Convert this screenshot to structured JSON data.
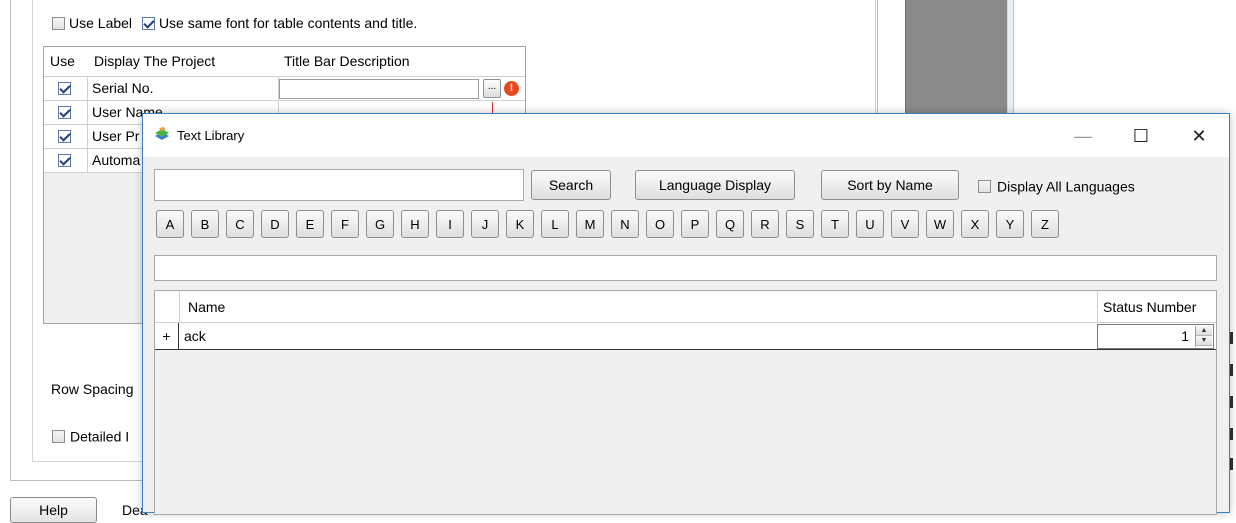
{
  "background_dialog": {
    "options": {
      "use_label": {
        "label": "Use Label",
        "checked": false
      },
      "same_font": {
        "label": "Use same font for table contents and title.",
        "checked": true
      }
    },
    "project_table": {
      "headers": [
        "Use",
        "Display The Project",
        "Title Bar Description"
      ],
      "rows": [
        {
          "checked": true,
          "label": "Serial No."
        },
        {
          "checked": true,
          "label": "User Name"
        },
        {
          "checked": true,
          "label": "User Pr"
        },
        {
          "checked": true,
          "label": "Automa"
        }
      ],
      "browse_button_label": "...",
      "error_icon_glyph": "!"
    },
    "row_spacing_label": "Row Spacing",
    "detailed_label": "Detailed I",
    "help_button_label": "Help",
    "partial_button_label": "Dea"
  },
  "text_library": {
    "window_title": "Text Library",
    "window_controls": {
      "minimize": "—",
      "maximize": "☐",
      "close": "✕"
    },
    "search_input": {
      "value": "",
      "placeholder": ""
    },
    "buttons": {
      "search": "Search",
      "language_display": "Language Display",
      "sort_by_name": "Sort by Name"
    },
    "display_all_languages": {
      "label": "Display All Languages",
      "checked": false
    },
    "letters": [
      "A",
      "B",
      "C",
      "D",
      "E",
      "F",
      "G",
      "H",
      "I",
      "J",
      "K",
      "L",
      "M",
      "N",
      "O",
      "P",
      "Q",
      "R",
      "S",
      "T",
      "U",
      "V",
      "W",
      "X",
      "Y",
      "Z"
    ],
    "filter_value": "",
    "grid": {
      "headers": {
        "name": "Name",
        "status_number": "Status Number"
      },
      "rows": [
        {
          "expand": "+",
          "name": "ack",
          "status_number": "1"
        }
      ]
    }
  },
  "colors": {
    "accent_border": "#3b7fc4",
    "error_icon": "#e8471d",
    "connector_line": "#d62a2a"
  }
}
